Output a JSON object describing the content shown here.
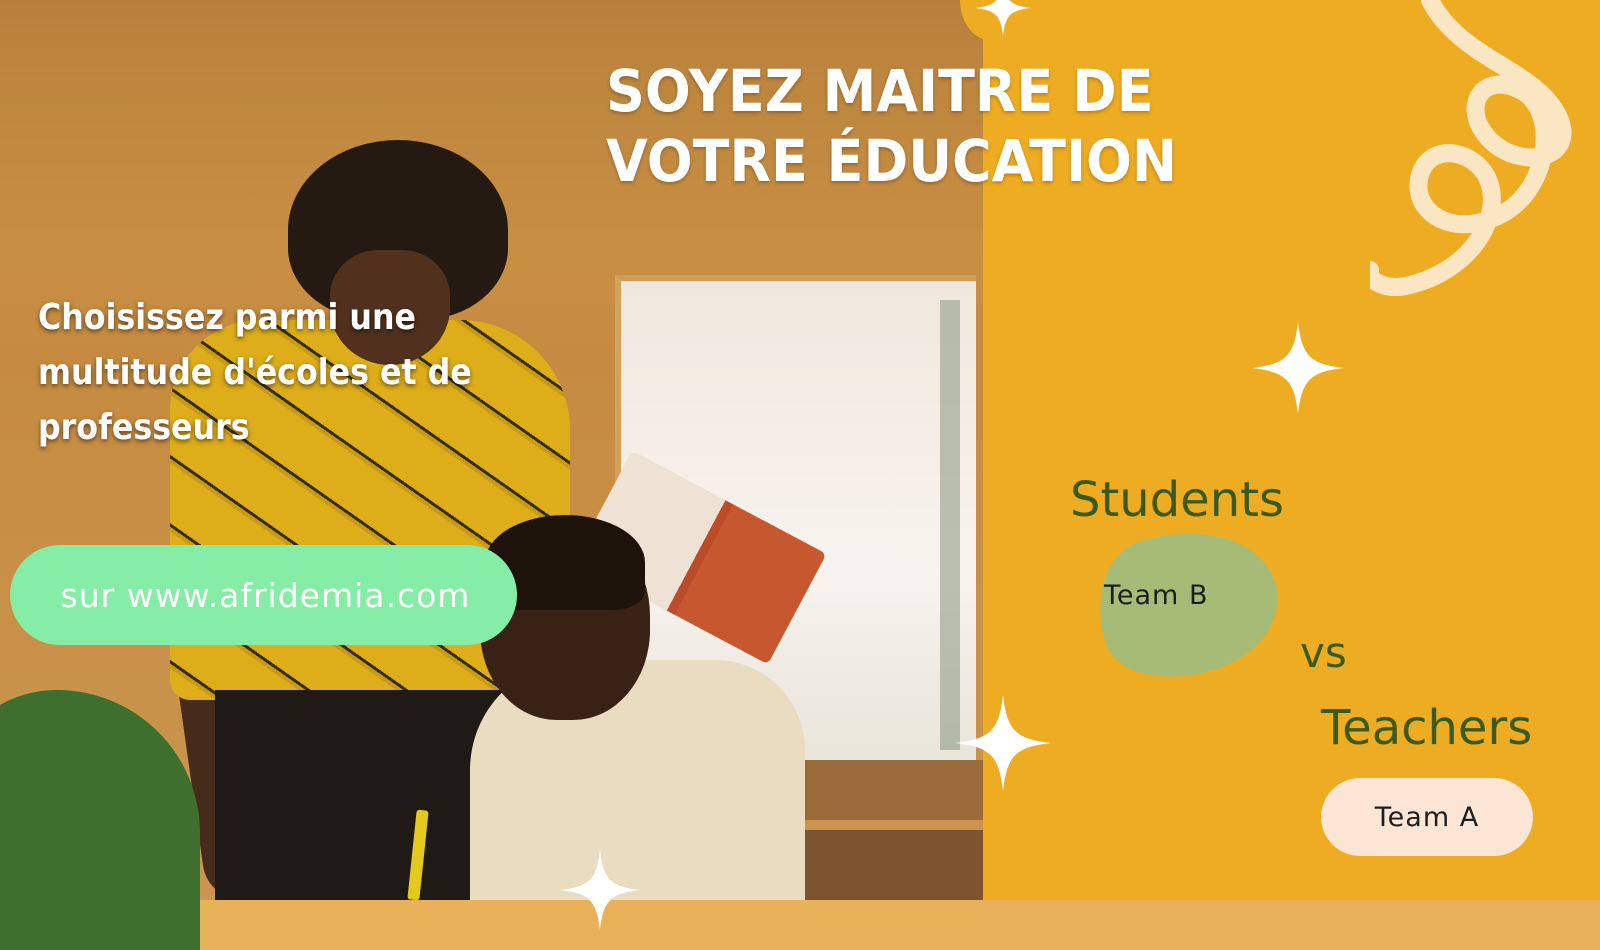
{
  "headline": {
    "line1": "SOYEZ MAITRE DE",
    "line2": "VOTRE ÉDUCATION"
  },
  "subtitle": "Choisissez parmi une multitude d'écoles et de professeurs",
  "url_pill": "sur www.afridemia.com",
  "students_label": "Students",
  "team_b_label": "Team B",
  "vs_label": "vs",
  "teachers_label": "Teachers",
  "team_a_label": "Team A",
  "colors": {
    "panel": "#eeac22",
    "pill_green": "#86eda6",
    "text_green": "#3b5b1e",
    "blob_green": "#a6bc76",
    "team_a_pill": "#fbe6d6",
    "dark_green_corner": "#3e6f2e",
    "swirl": "#fbe6c4"
  },
  "icons": [
    "sparkle-icon",
    "swirl-decoration"
  ]
}
